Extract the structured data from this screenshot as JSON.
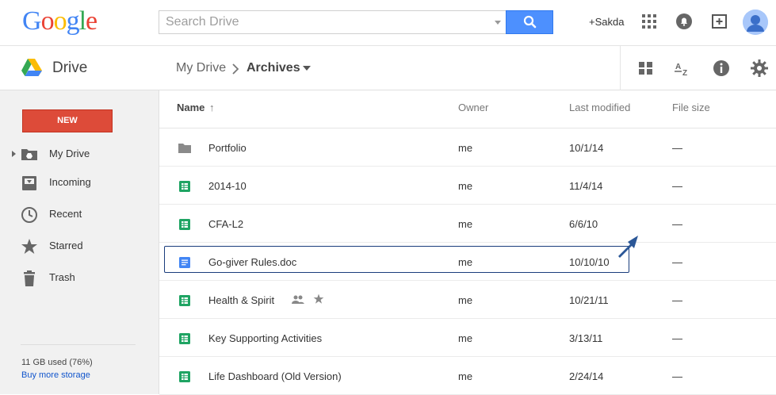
{
  "topbar": {
    "logo_letters": [
      "G",
      "o",
      "o",
      "g",
      "l",
      "e"
    ],
    "logo_colors": [
      "#4285f4",
      "#ea4335",
      "#fbbc05",
      "#4285f4",
      "#34a853",
      "#ea4335"
    ],
    "search_placeholder": "Search Drive",
    "user_link": "+Sakda"
  },
  "subbar": {
    "app_title": "Drive",
    "breadcrumb": [
      "My Drive",
      "Archives"
    ]
  },
  "sidebar": {
    "new_label": "NEW",
    "items": [
      {
        "label": "My Drive",
        "icon": "drive-folder-icon"
      },
      {
        "label": "Incoming",
        "icon": "inbox-icon"
      },
      {
        "label": "Recent",
        "icon": "clock-icon"
      },
      {
        "label": "Starred",
        "icon": "star-icon"
      },
      {
        "label": "Trash",
        "icon": "trash-icon"
      }
    ],
    "storage_used": "11 GB used (76%)",
    "buy_storage": "Buy more storage"
  },
  "list": {
    "columns": [
      "Name",
      "Owner",
      "Last modified",
      "File size"
    ],
    "sort_indicator": "↑",
    "rows": [
      {
        "name": "Portfolio",
        "type": "folder",
        "owner": "me",
        "modified": "10/1/14",
        "size": "—"
      },
      {
        "name": "2014-10",
        "type": "sheet",
        "owner": "me",
        "modified": "11/4/14",
        "size": "—"
      },
      {
        "name": "CFA-L2",
        "type": "sheet",
        "owner": "me",
        "modified": "6/6/10",
        "size": "—"
      },
      {
        "name": "Go-giver Rules.doc",
        "type": "doc",
        "owner": "me",
        "modified": "10/10/10",
        "size": "—",
        "selected": true
      },
      {
        "name": "Health & Spirit",
        "type": "sheet",
        "owner": "me",
        "modified": "10/21/11",
        "size": "—",
        "shared": true,
        "starred": true
      },
      {
        "name": "Key Supporting Activities",
        "type": "sheet",
        "owner": "me",
        "modified": "3/13/11",
        "size": "—"
      },
      {
        "name": "Life Dashboard (Old Version)",
        "type": "sheet",
        "owner": "me",
        "modified": "2/24/14",
        "size": "—"
      }
    ]
  },
  "colors": {
    "accent_blue": "#4d90fe",
    "new_red": "#dd4b39",
    "sheet_green": "#1fa463",
    "doc_blue": "#4285f4",
    "selection_border": "#1a3d7c"
  }
}
